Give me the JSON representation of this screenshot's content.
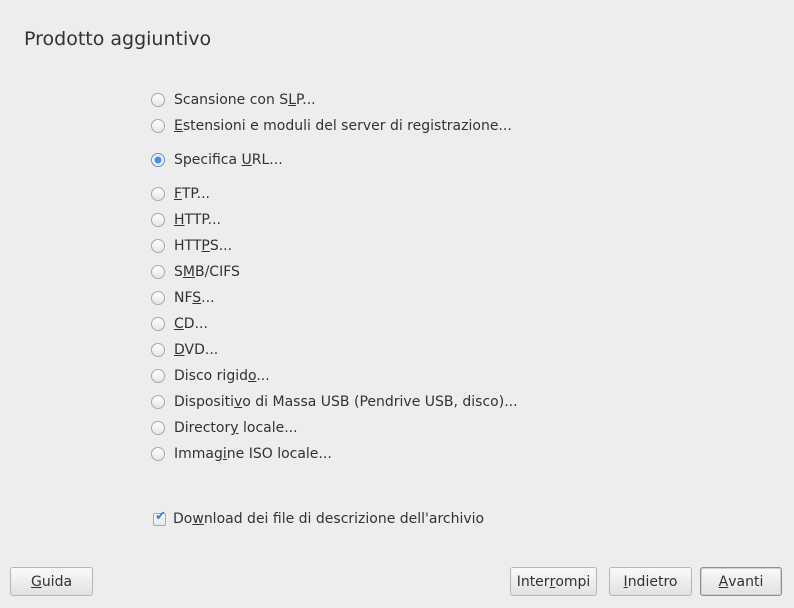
{
  "window": {
    "title": "Prodotto aggiuntivo"
  },
  "options": [
    {
      "pre": "Scansione con S",
      "ul": "L",
      "post": "P...",
      "checked": false
    },
    {
      "pre": "",
      "ul": "E",
      "post": "stensioni e moduli del server di registrazione...",
      "checked": false
    },
    {
      "pre": "Specifica ",
      "ul": "U",
      "post": "RL...",
      "checked": true
    },
    {
      "pre": "",
      "ul": "F",
      "post": "TP...",
      "checked": false
    },
    {
      "pre": "",
      "ul": "H",
      "post": "TTP...",
      "checked": false
    },
    {
      "pre": "HTT",
      "ul": "P",
      "post": "S...",
      "checked": false
    },
    {
      "pre": "S",
      "ul": "M",
      "post": "B/CIFS",
      "checked": false
    },
    {
      "pre": "NF",
      "ul": "S",
      "post": "...",
      "checked": false
    },
    {
      "pre": "",
      "ul": "C",
      "post": "D...",
      "checked": false
    },
    {
      "pre": "",
      "ul": "D",
      "post": "VD...",
      "checked": false
    },
    {
      "pre": "Disco rigid",
      "ul": "o",
      "post": "...",
      "checked": false
    },
    {
      "pre": "Dispositi",
      "ul": "v",
      "post": "o di Massa USB (Pendrive USB, disco)...",
      "checked": false
    },
    {
      "pre": "Director",
      "ul": "y",
      "post": " locale...",
      "checked": false
    },
    {
      "pre": "Immag",
      "ul": "i",
      "post": "ne ISO locale...",
      "checked": false
    }
  ],
  "download_checkbox": {
    "pre": "Do",
    "ul": "w",
    "post": "nload dei file di descrizione dell'archivio",
    "checked": true
  },
  "buttons": {
    "help": {
      "ul": "G",
      "post": "uida"
    },
    "abort": {
      "pre": "Inter",
      "ul": "r",
      "post": "ompi"
    },
    "back": {
      "ul": "I",
      "post": "ndietro"
    },
    "next": {
      "ul": "A",
      "post": "vanti"
    }
  }
}
